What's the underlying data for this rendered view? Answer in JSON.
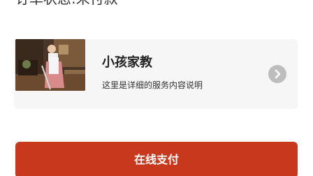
{
  "order": {
    "status_text": "订单状态:未付款"
  },
  "service_card": {
    "title": "小孩家教",
    "description": "这里是详细的服务内容说明",
    "thumbnail_icon": "photo-housekeeping",
    "arrow_icon": "chevron-right-icon"
  },
  "actions": {
    "pay_label": "在线支付",
    "pay_color": "#c8381c"
  }
}
